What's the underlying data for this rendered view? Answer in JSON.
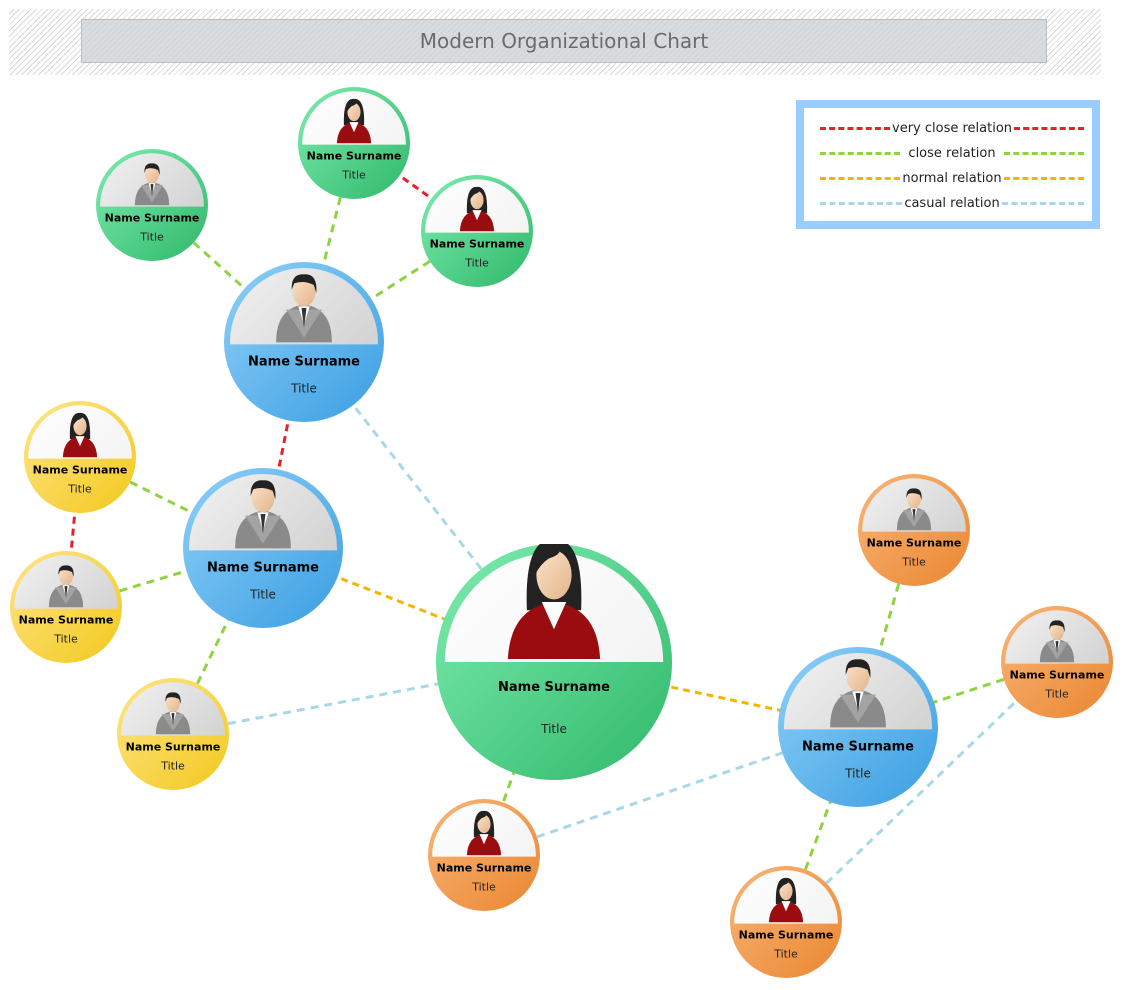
{
  "title": "Modern Organizational Chart",
  "legend": [
    {
      "label": "very close relation",
      "color": "#e8202a",
      "kind": "very_close"
    },
    {
      "label": "close relation",
      "color": "#8ed340",
      "kind": "close"
    },
    {
      "label": "normal relation",
      "color": "#f5b400",
      "kind": "normal"
    },
    {
      "label": "casual relation",
      "color": "#a8d8e8",
      "kind": "casual"
    }
  ],
  "palettes": {
    "green": {
      "light": "#7eedb0",
      "dark": "#2fb86a"
    },
    "blue": {
      "light": "#8fd0f8",
      "dark": "#3a9ee2"
    },
    "yellow": {
      "light": "#ffe58a",
      "dark": "#f2c91c"
    },
    "orange": {
      "light": "#f9b67a",
      "dark": "#ea8630"
    }
  },
  "nodes": [
    {
      "id": "ceo",
      "name": "Name Surname",
      "title": "Title",
      "color": "green",
      "avatar": "female",
      "size": "xl"
    },
    {
      "id": "mgr-top",
      "name": "Name Surname",
      "title": "Title",
      "color": "blue",
      "avatar": "male",
      "size": "l"
    },
    {
      "id": "mgr-left",
      "name": "Name Surname",
      "title": "Title",
      "color": "blue",
      "avatar": "male",
      "size": "l"
    },
    {
      "id": "mgr-right",
      "name": "Name Surname",
      "title": "Title",
      "color": "blue",
      "avatar": "male",
      "size": "l"
    },
    {
      "id": "g1",
      "name": "Name Surname",
      "title": "Title",
      "color": "green",
      "avatar": "male",
      "size": "s"
    },
    {
      "id": "g2",
      "name": "Name Surname",
      "title": "Title",
      "color": "green",
      "avatar": "female",
      "size": "s"
    },
    {
      "id": "g3",
      "name": "Name Surname",
      "title": "Title",
      "color": "green",
      "avatar": "female",
      "size": "s"
    },
    {
      "id": "y1",
      "name": "Name Surname",
      "title": "Title",
      "color": "yellow",
      "avatar": "female",
      "size": "s"
    },
    {
      "id": "y2",
      "name": "Name Surname",
      "title": "Title",
      "color": "yellow",
      "avatar": "male",
      "size": "s"
    },
    {
      "id": "y3",
      "name": "Name Surname",
      "title": "Title",
      "color": "yellow",
      "avatar": "male",
      "size": "s"
    },
    {
      "id": "o1",
      "name": "Name Surname",
      "title": "Title",
      "color": "orange",
      "avatar": "male",
      "size": "s"
    },
    {
      "id": "o2",
      "name": "Name Surname",
      "title": "Title",
      "color": "orange",
      "avatar": "male",
      "size": "s"
    },
    {
      "id": "o3",
      "name": "Name Surname",
      "title": "Title",
      "color": "orange",
      "avatar": "female",
      "size": "s"
    },
    {
      "id": "o4",
      "name": "Name Surname",
      "title": "Title",
      "color": "orange",
      "avatar": "female",
      "size": "s"
    }
  ],
  "links": [
    {
      "from": "g1",
      "to": "mgr-top",
      "kind": "close"
    },
    {
      "from": "g2",
      "to": "mgr-top",
      "kind": "close"
    },
    {
      "from": "g3",
      "to": "mgr-top",
      "kind": "close"
    },
    {
      "from": "g2",
      "to": "g3",
      "kind": "very_close"
    },
    {
      "from": "mgr-top",
      "to": "mgr-left",
      "kind": "very_close"
    },
    {
      "from": "mgr-top",
      "to": "ceo",
      "kind": "casual"
    },
    {
      "from": "y1",
      "to": "mgr-left",
      "kind": "close"
    },
    {
      "from": "y2",
      "to": "mgr-left",
      "kind": "close"
    },
    {
      "from": "y3",
      "to": "mgr-left",
      "kind": "close"
    },
    {
      "from": "y1",
      "to": "y2",
      "kind": "very_close"
    },
    {
      "from": "mgr-left",
      "to": "ceo",
      "kind": "normal"
    },
    {
      "from": "y3",
      "to": "ceo",
      "kind": "casual"
    },
    {
      "from": "ceo",
      "to": "mgr-right",
      "kind": "normal"
    },
    {
      "from": "ceo",
      "to": "o3",
      "kind": "close"
    },
    {
      "from": "o3",
      "to": "mgr-right",
      "kind": "casual"
    },
    {
      "from": "o1",
      "to": "mgr-right",
      "kind": "close"
    },
    {
      "from": "o2",
      "to": "mgr-right",
      "kind": "close"
    },
    {
      "from": "o4",
      "to": "mgr-right",
      "kind": "close"
    },
    {
      "from": "o4",
      "to": "o2",
      "kind": "casual"
    }
  ]
}
